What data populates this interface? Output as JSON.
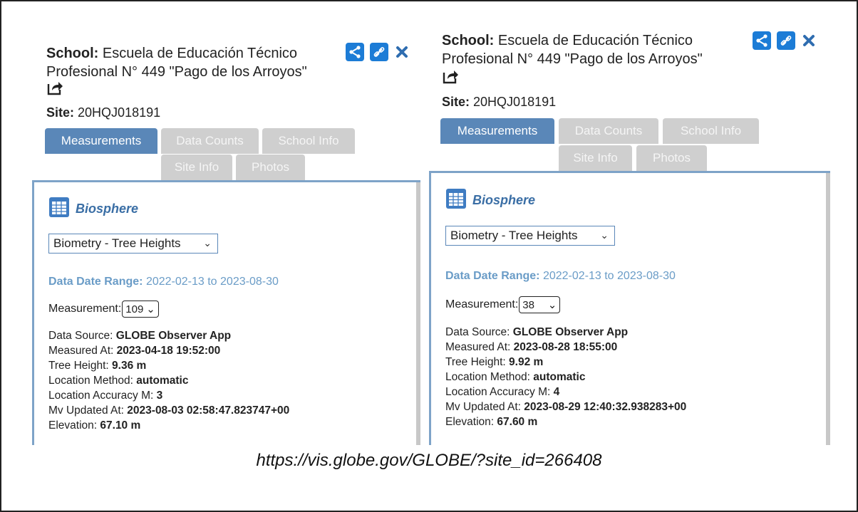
{
  "panels": {
    "left": {
      "school_label": "School:",
      "school_name": "Escuela de Educación Técnico Profesional N° 449 \"Pago de los Arroyos\"",
      "site_label": "Site:",
      "site_value": "20HQJ018191",
      "tabs": [
        "Measurements",
        "Data Counts",
        "School Info",
        "Site Info",
        "Photos"
      ],
      "section_title": "Biosphere",
      "protocol_select": "Biometry - Tree Heights",
      "range_label": "Data Date Range:",
      "range_value": "2022-02-13 to 2023-08-30",
      "measurement_label": "Measurement:",
      "measurement_value": "109",
      "rows": [
        {
          "label": "Data Source:",
          "value": "GLOBE Observer App"
        },
        {
          "label": "Measured At:",
          "value": "2023-04-18 19:52:00"
        },
        {
          "label": "Tree Height:",
          "value": "9.36 m"
        },
        {
          "label": "Location Method:",
          "value": "automatic"
        },
        {
          "label": "Location Accuracy M:",
          "value": "3"
        },
        {
          "label": "Mv Updated At:",
          "value": "2023-08-03 02:58:47.823747+00"
        },
        {
          "label": "Elevation:",
          "value": "67.10 m"
        }
      ]
    },
    "right": {
      "school_label": "School:",
      "school_name": "Escuela de Educación Técnico Profesional N° 449 \"Pago de los Arroyos\"",
      "site_label": "Site:",
      "site_value": "20HQJ018191",
      "tabs": [
        "Measurements",
        "Data Counts",
        "School Info",
        "Site Info",
        "Photos"
      ],
      "section_title": "Biosphere",
      "protocol_select": "Biometry - Tree Heights",
      "range_label": "Data Date Range:",
      "range_value": "2022-02-13 to 2023-08-30",
      "measurement_label": "Measurement:",
      "measurement_value": "38",
      "rows": [
        {
          "label": "Data Source:",
          "value": "GLOBE Observer App"
        },
        {
          "label": "Measured At:",
          "value": "2023-08-28 18:55:00"
        },
        {
          "label": "Tree Height:",
          "value": "9.92 m"
        },
        {
          "label": "Location Method:",
          "value": "automatic"
        },
        {
          "label": "Location Accuracy M:",
          "value": "4"
        },
        {
          "label": "Mv Updated At:",
          "value": "2023-08-29 12:40:32.938283+00"
        },
        {
          "label": "Elevation:",
          "value": "67.60 m"
        }
      ]
    }
  },
  "caption": "https://vis.globe.gov/GLOBE/?site_id=266408",
  "colors": {
    "active_tab": "#5a87b8",
    "inactive_tab": "#cfcfcf",
    "accent": "#1c7cd6",
    "range_text": "#6a9cc7"
  }
}
